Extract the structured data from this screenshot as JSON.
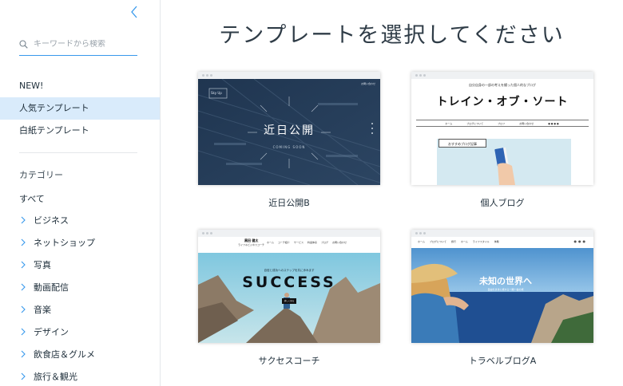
{
  "sidebar": {
    "search_placeholder": "キーワードから検索",
    "nav": [
      {
        "label": "NEW!",
        "active": false
      },
      {
        "label": "人気テンプレート",
        "active": true
      },
      {
        "label": "白紙テンプレート",
        "active": false
      }
    ],
    "category_heading": "カテゴリー",
    "category_all": "すべて",
    "categories": [
      "ビジネス",
      "ネットショップ",
      "写真",
      "動画配信",
      "音楽",
      "デザイン",
      "飲食店＆グルメ",
      "旅行＆観光"
    ]
  },
  "main": {
    "title": "テンプレートを選択してください",
    "templates": [
      {
        "label": "近日公開B",
        "headline": "近日公開",
        "sub": "COMING SOON",
        "logo": "Sky Up",
        "nav": "お問い合わせ"
      },
      {
        "label": "個人ブログ",
        "headline": "トレイン・オブ・ソート",
        "tagline": "自分自身の一部の考えを綴った個人的なブログ",
        "nav": [
          "ホーム",
          "ブログについて",
          "プロフ",
          "お問い合わせ"
        ],
        "feature": "おすすめブログ記事"
      },
      {
        "label": "サクセスコーチ",
        "headline": "SUCCESS",
        "tagline": "自信と成功へのステップを共に歩みます",
        "logo": "黒田 健太",
        "logo_sub": "ライフ＆ビジネスコーチ",
        "button": "詳しく見る",
        "nav": [
          "ホーム",
          "コーチ紹介",
          "サービス",
          "料金体系",
          "ブログ",
          "お問い合わせ"
        ]
      },
      {
        "label": "トラベルブログA",
        "headline": "未知の世界へ",
        "sub": "自由気ままに旅する一期一会の旅",
        "nav": [
          "ホーム",
          "ブログについて",
          "旅行",
          "ホーム",
          "ライフスタイル",
          "体験"
        ]
      }
    ]
  },
  "colors": {
    "accent": "#3899ec",
    "active_bg": "#d9ebfb"
  }
}
